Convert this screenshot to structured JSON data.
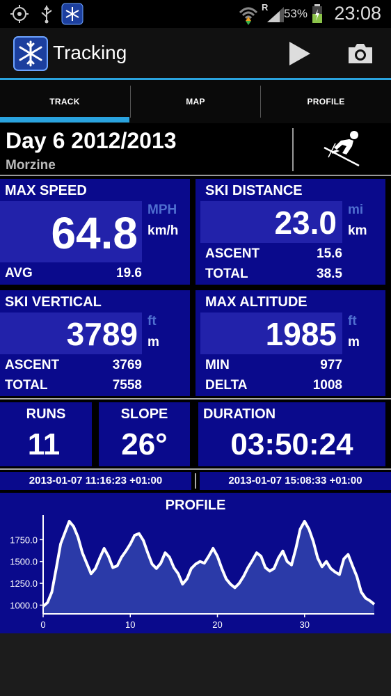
{
  "status_bar": {
    "battery_pct": "53%",
    "time": "23:08",
    "signal_roaming": "R"
  },
  "action_bar": {
    "title": "Tracking"
  },
  "tabs": [
    {
      "label": "TRACK"
    },
    {
      "label": "MAP"
    },
    {
      "label": "PROFILE"
    }
  ],
  "day": {
    "title": "Day 6 2012/2013",
    "location": "Morzine"
  },
  "max_speed": {
    "title": "MAX SPEED",
    "value": "64.8",
    "unit_alt": "MPH",
    "unit": "km/h",
    "avg_label": "AVG",
    "avg_value": "19.6"
  },
  "ski_distance": {
    "title": "SKI DISTANCE",
    "value": "23.0",
    "unit_alt": "mi",
    "unit": "km",
    "ascent_label": "ASCENT",
    "ascent_value": "15.6",
    "total_label": "TOTAL",
    "total_value": "38.5"
  },
  "ski_vertical": {
    "title": "SKI VERTICAL",
    "value": "3789",
    "unit_alt": "ft",
    "unit": "m",
    "ascent_label": "ASCENT",
    "ascent_value": "3769",
    "total_label": "TOTAL",
    "total_value": "7558"
  },
  "max_altitude": {
    "title": "MAX ALTITUDE",
    "value": "1985",
    "unit_alt": "ft",
    "unit": "m",
    "min_label": "MIN",
    "min_value": "977",
    "delta_label": "DELTA",
    "delta_value": "1008"
  },
  "runs": {
    "title": "RUNS",
    "value": "11"
  },
  "slope": {
    "title": "SLOPE",
    "value": "26°"
  },
  "duration": {
    "title": "DURATION",
    "value": "03:50:24"
  },
  "timestamps": {
    "start": "2013-01-07 11:16:23 +01:00",
    "end": "2013-01-07 15:08:33 +01:00"
  },
  "colors": {
    "accent": "#2aa3df",
    "panel": "#0a0a8c",
    "highlight": "#2222aa"
  },
  "chart_data": {
    "type": "area",
    "title": "PROFILE",
    "xlabel": "",
    "ylabel": "",
    "xlim": [
      0,
      38
    ],
    "ylim": [
      900,
      2000
    ],
    "xticks": [
      0,
      10,
      20,
      30
    ],
    "yticks": [
      1000.0,
      1250.0,
      1500.0,
      1750.0
    ],
    "ytick_labels": [
      "1000.0",
      "1250.0",
      "1500.0",
      "1750.0"
    ],
    "xtick_labels": [
      "0",
      "10",
      "20",
      "30"
    ],
    "x": [
      0,
      0.5,
      1,
      1.5,
      2,
      2.5,
      3,
      3.5,
      4,
      4.5,
      5,
      5.5,
      6,
      6.5,
      7,
      7.5,
      8,
      8.5,
      9,
      9.5,
      10,
      10.5,
      11,
      11.5,
      12,
      12.5,
      13,
      13.5,
      14,
      14.5,
      15,
      15.5,
      16,
      16.5,
      17,
      17.5,
      18,
      18.5,
      19,
      19.5,
      20,
      20.5,
      21,
      21.5,
      22,
      22.5,
      23,
      23.5,
      24,
      24.5,
      25,
      25.5,
      26,
      26.5,
      27,
      27.5,
      28,
      28.5,
      29,
      29.5,
      30,
      30.5,
      31,
      31.5,
      32,
      32.5,
      33,
      33.5,
      34,
      34.5,
      35,
      35.5,
      36,
      36.5,
      37,
      37.5,
      38
    ],
    "y": [
      985,
      1030,
      1150,
      1420,
      1700,
      1830,
      1960,
      1900,
      1780,
      1600,
      1480,
      1360,
      1420,
      1540,
      1650,
      1560,
      1430,
      1450,
      1550,
      1620,
      1700,
      1800,
      1820,
      1740,
      1600,
      1470,
      1420,
      1480,
      1600,
      1550,
      1430,
      1360,
      1240,
      1300,
      1420,
      1470,
      1500,
      1480,
      1560,
      1650,
      1560,
      1420,
      1300,
      1240,
      1200,
      1250,
      1330,
      1430,
      1510,
      1600,
      1560,
      1430,
      1390,
      1420,
      1540,
      1620,
      1500,
      1460,
      1650,
      1870,
      1960,
      1870,
      1730,
      1540,
      1440,
      1500,
      1420,
      1380,
      1350,
      1530,
      1580,
      1450,
      1330,
      1150,
      1080,
      1050,
      1010
    ]
  }
}
